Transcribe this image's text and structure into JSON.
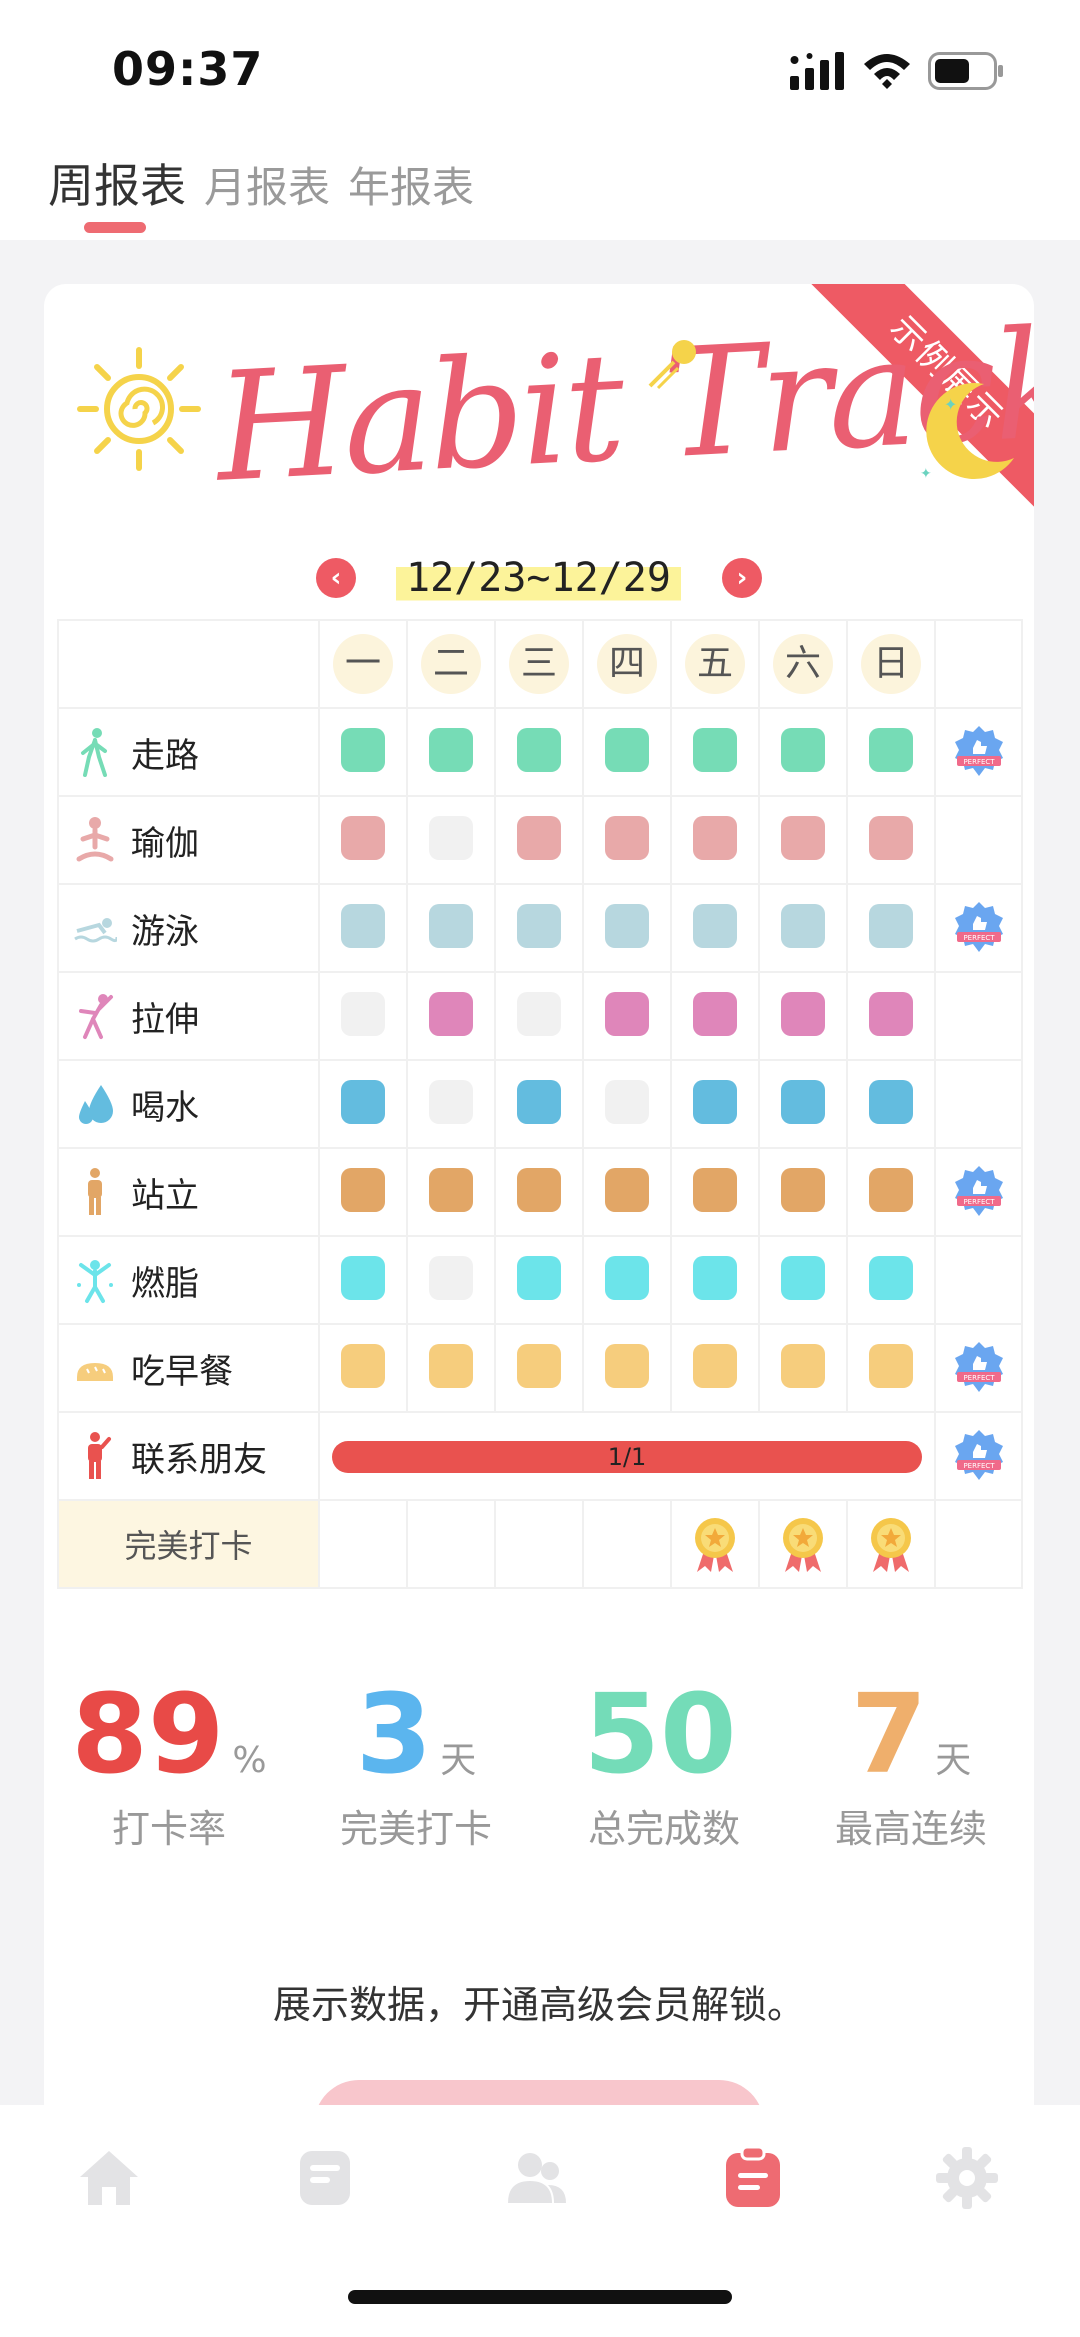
{
  "status_bar": {
    "time": "09:37"
  },
  "tabs": [
    {
      "label": "周报表",
      "active": true
    },
    {
      "label": "月报表",
      "active": false
    },
    {
      "label": "年报表",
      "active": false
    }
  ],
  "header": {
    "title": "Habit Tracker",
    "ribbon": "示例展示"
  },
  "week": {
    "range": "12/23~12/29",
    "prev": "‹",
    "next": "›"
  },
  "days": [
    "一",
    "二",
    "三",
    "四",
    "五",
    "六",
    "日"
  ],
  "habits": [
    {
      "name": "走路",
      "color": "#76dcb6",
      "icon": "walking-icon",
      "done": [
        1,
        1,
        1,
        1,
        1,
        1,
        1
      ],
      "perfect": true
    },
    {
      "name": "瑜伽",
      "color": "#e8a9a9",
      "icon": "yoga-icon",
      "done": [
        1,
        0,
        1,
        1,
        1,
        1,
        1
      ],
      "perfect": false
    },
    {
      "name": "游泳",
      "color": "#b7d7df",
      "icon": "swimming-icon",
      "done": [
        1,
        1,
        1,
        1,
        1,
        1,
        1
      ],
      "perfect": true
    },
    {
      "name": "拉伸",
      "color": "#df86ba",
      "icon": "stretch-icon",
      "done": [
        0,
        1,
        0,
        1,
        1,
        1,
        1
      ],
      "perfect": false
    },
    {
      "name": "喝水",
      "color": "#63bcdf",
      "icon": "water-drop-icon",
      "done": [
        1,
        0,
        1,
        0,
        1,
        1,
        1
      ],
      "perfect": false
    },
    {
      "name": "站立",
      "color": "#e2a666",
      "icon": "standing-icon",
      "done": [
        1,
        1,
        1,
        1,
        1,
        1,
        1
      ],
      "perfect": true
    },
    {
      "name": "燃脂",
      "color": "#6ce4ea",
      "icon": "fat-burn-icon",
      "done": [
        1,
        0,
        1,
        1,
        1,
        1,
        1
      ],
      "perfect": false
    },
    {
      "name": "吃早餐",
      "color": "#f6cd7d",
      "icon": "bread-icon",
      "done": [
        1,
        1,
        1,
        1,
        1,
        1,
        1
      ],
      "perfect": true
    }
  ],
  "friend_habit": {
    "name": "联系朋友",
    "progress": "1/1",
    "color": "#e9524f",
    "icon": "person-icon",
    "perfect": true
  },
  "perfect_row": {
    "label": "完美打卡",
    "medals": [
      0,
      0,
      0,
      0,
      1,
      1,
      1
    ]
  },
  "stats": [
    {
      "value": "89",
      "unit": "%",
      "label": "打卡率",
      "color": "#e84a47"
    },
    {
      "value": "3",
      "unit": "天",
      "label": "完美打卡",
      "color": "#5bb5ee"
    },
    {
      "value": "50",
      "unit": "",
      "label": "总完成数",
      "color": "#74dcb8"
    },
    {
      "value": "7",
      "unit": "天",
      "label": "最高连续",
      "color": "#efaf6c"
    }
  ],
  "promo": {
    "text": "展示数据，开通高级会员解锁。"
  },
  "bottom_nav": [
    {
      "icon": "home-icon",
      "active": false
    },
    {
      "icon": "document-icon",
      "active": false
    },
    {
      "icon": "users-icon",
      "active": false
    },
    {
      "icon": "clipboard-icon",
      "active": true
    },
    {
      "icon": "gear-icon",
      "active": false
    }
  ]
}
